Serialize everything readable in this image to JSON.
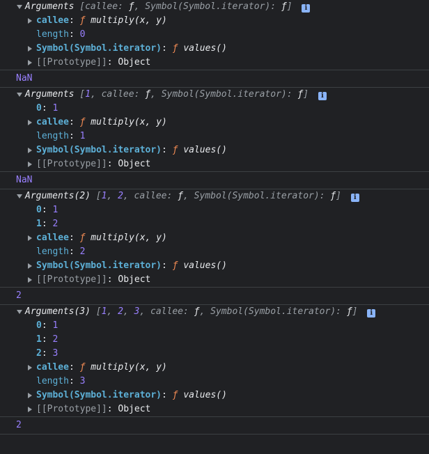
{
  "groups": [
    {
      "header": {
        "prefix": "Arguments",
        "open": " [",
        "items_text": "",
        "callee_key": "callee",
        "callee_val": "ƒ",
        "sym_key": "Symbol(Symbol.iterator)",
        "sym_val": "ƒ",
        "close": "]"
      },
      "children": [
        {
          "type": "callee",
          "key": "callee",
          "fsym": "ƒ",
          "fname": "multiply(x, y)"
        },
        {
          "type": "length",
          "key": "length",
          "value": "0"
        },
        {
          "type": "symbol",
          "key": "Symbol(Symbol.iterator)",
          "fsym": "ƒ",
          "fname": "values()"
        },
        {
          "type": "proto",
          "key": "[[Prototype]]",
          "value": "Object"
        }
      ],
      "result": "NaN"
    },
    {
      "header": {
        "prefix": "Arguments",
        "items": [
          "1"
        ]
      },
      "indexed": [
        {
          "i": "0",
          "v": "1"
        }
      ],
      "children": [
        {
          "key": "callee",
          "fsym": "ƒ",
          "fname": "multiply(x, y)"
        },
        {
          "key": "length",
          "value": "1"
        },
        {
          "key": "Symbol(Symbol.iterator)",
          "fsym": "ƒ",
          "fname": "values()"
        },
        {
          "key": "[[Prototype]]",
          "value": "Object"
        }
      ],
      "result": "NaN"
    },
    {
      "header": {
        "prefix": "Arguments(2)",
        "items": [
          "1",
          "2"
        ]
      },
      "indexed": [
        {
          "i": "0",
          "v": "1"
        },
        {
          "i": "1",
          "v": "2"
        }
      ],
      "children": [
        {
          "key": "callee",
          "fsym": "ƒ",
          "fname": "multiply(x, y)"
        },
        {
          "key": "length",
          "value": "2"
        },
        {
          "key": "Symbol(Symbol.iterator)",
          "fsym": "ƒ",
          "fname": "values()"
        },
        {
          "key": "[[Prototype]]",
          "value": "Object"
        }
      ],
      "result": "2"
    },
    {
      "header": {
        "prefix": "Arguments(3)",
        "items": [
          "1",
          "2",
          "3"
        ]
      },
      "indexed": [
        {
          "i": "0",
          "v": "1"
        },
        {
          "i": "1",
          "v": "2"
        },
        {
          "i": "2",
          "v": "3"
        }
      ],
      "children": [
        {
          "key": "callee",
          "fsym": "ƒ",
          "fname": "multiply(x, y)"
        },
        {
          "key": "length",
          "value": "3"
        },
        {
          "key": "Symbol(Symbol.iterator)",
          "fsym": "ƒ",
          "fname": "values()"
        },
        {
          "key": "[[Prototype]]",
          "value": "Object"
        }
      ],
      "result": "2"
    }
  ],
  "labels": {
    "callee": "callee",
    "f": "ƒ",
    "symbol_iterator": "Symbol(Symbol.iterator)",
    "info": "i"
  }
}
